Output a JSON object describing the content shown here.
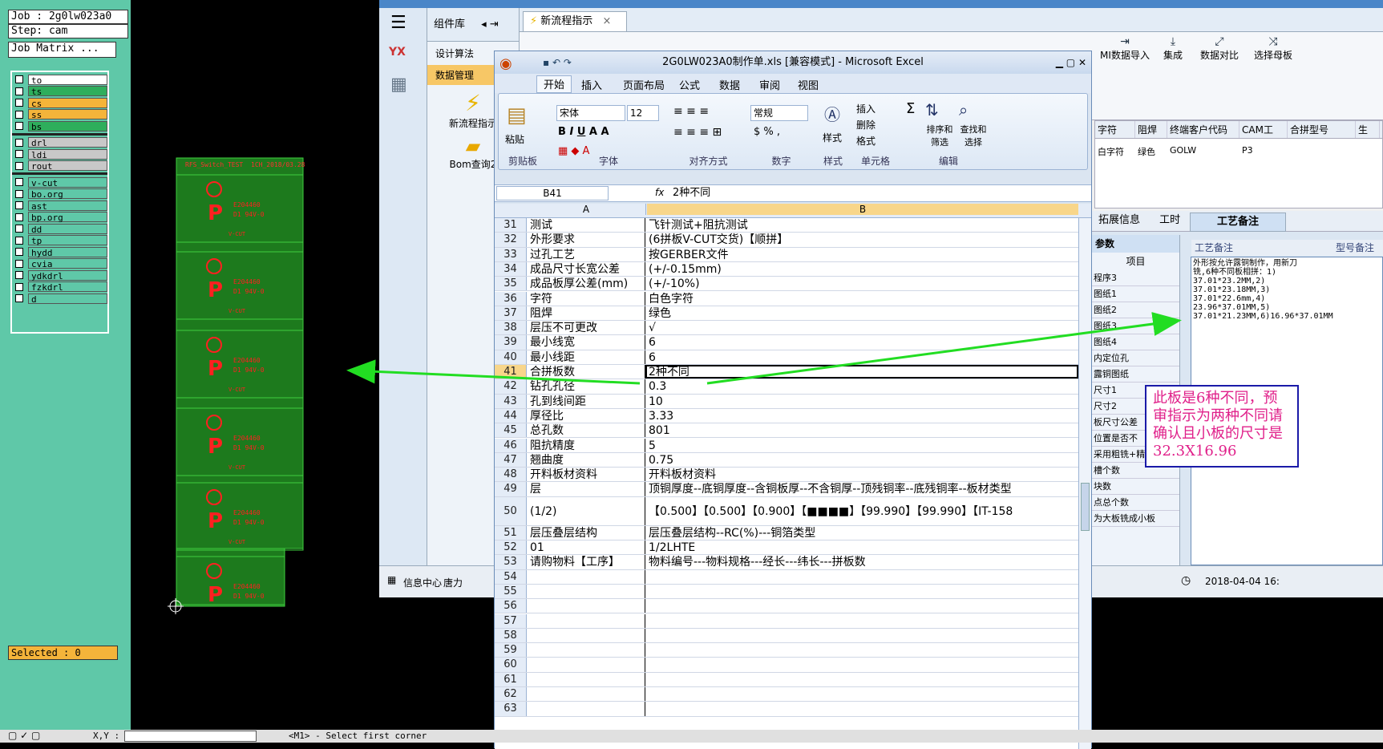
{
  "cam": {
    "job": "Job : 2g0lw023a0",
    "step": "Step: cam",
    "matrix": "Job Matrix ...",
    "layers": [
      {
        "name": "to",
        "color": "#ffffff"
      },
      {
        "name": "ts",
        "color": "#2eae5c"
      },
      {
        "name": "cs",
        "color": "#f4b43a"
      },
      {
        "name": "ss",
        "color": "#f4b43a"
      },
      {
        "name": "bs",
        "color": "#2eae5c"
      },
      {
        "name": "drl",
        "color": "#c8c8c8"
      },
      {
        "name": "ldi",
        "color": "#c8c8c8"
      },
      {
        "name": "rout",
        "color": "#c8c8c8"
      },
      {
        "name": "v-cut",
        "color": "#5fc8a8"
      },
      {
        "name": "bo.org",
        "color": "#5fc8a8"
      },
      {
        "name": "ast",
        "color": "#5fc8a8"
      },
      {
        "name": "bp.org",
        "color": "#5fc8a8"
      },
      {
        "name": "dd",
        "color": "#5fc8a8"
      },
      {
        "name": "tp",
        "color": "#5fc8a8"
      },
      {
        "name": "hydd",
        "color": "#5fc8a8"
      },
      {
        "name": "cvia",
        "color": "#5fc8a8"
      },
      {
        "name": "ydkdrl",
        "color": "#5fc8a8"
      },
      {
        "name": "fzkdrl",
        "color": "#5fc8a8"
      },
      {
        "name": "d",
        "color": "#5fc8a8"
      }
    ],
    "selected": "Selected : 0",
    "pcb_header_left": "RFS_Switch_TEST",
    "pcb_header_right": "1CH_2018/03.28",
    "pcb_code": "E204460",
    "pcb_rating": "D1 94V-0",
    "vcut": "V-CUT",
    "xy": "X,Y :",
    "prompt": "<M1> - Select first corner"
  },
  "bgapp": {
    "complib": "组件库",
    "tab": "新流程指示",
    "nav_items": [
      "设计算法",
      "数据管理"
    ],
    "tool_items": [
      "新流程指示",
      "Bom查询2"
    ],
    "ribbon_buttons": [
      "MI数据导入",
      "集成",
      "数据对比",
      "选择母板"
    ],
    "table_headers": [
      "字符",
      "阻焊",
      "终端客户代码",
      "CAM工",
      "合拼型号",
      "生"
    ],
    "table_row": [
      "白字符",
      "绿色",
      "GOLW",
      "P3"
    ],
    "subtabs": [
      "拓展信息",
      "工时"
    ],
    "left_list_header": "参数",
    "left_list_col": "项目",
    "left_list": [
      "程序3",
      "图纸1",
      "图纸2",
      "图纸3",
      "图纸4",
      "内定位孔",
      "露铜图纸",
      "尺寸1",
      "尺寸2",
      "板尺寸公差",
      "位置是否不",
      "采用粗铣+精铣",
      "槽个数",
      "块数",
      "点总个数",
      "为大板铣成小板"
    ],
    "note_tab": "工艺备注",
    "note_header": "工艺备注",
    "note_header2": "型号备注",
    "note_lines": [
      "外形按允许露铜制作，用新刀",
      "铣,6种不同板相拼：1)",
      "37.01*23.2MM,2)",
      "37.01*23.18MM,3)",
      "37.01*22.6mm,4)",
      "23.96*37.01MM,5)",
      "37.01*21.23MM,6)16.96*37.01MM"
    ],
    "bottom_left": "信息中心",
    "bottom_left2": "唐力",
    "bottom_right": "2018-04-04 16:"
  },
  "excel": {
    "title": "2G0LW023A0制作单.xls [兼容模式] - Microsoft Excel",
    "tabs": [
      "开始",
      "插入",
      "页面布局",
      "公式",
      "数据",
      "审阅",
      "视图"
    ],
    "groups": [
      "剪贴板",
      "字体",
      "对齐方式",
      "数字",
      "样式",
      "单元格",
      "编辑"
    ],
    "paste": "粘贴",
    "font_name": "宋体",
    "font_size": "12",
    "number_format": "常规",
    "insert": "插入",
    "delete": "删除",
    "format": "格式",
    "style": "样式",
    "sort": "排序和筛选",
    "find": "查找和选择",
    "namebox": "B41",
    "formula": "2种不同",
    "col_a": "A",
    "col_b": "B",
    "rows": [
      [
        "31",
        "测试",
        "飞针测试+阻抗测试"
      ],
      [
        "32",
        "外形要求",
        "(6拼板V-CUT交货)【顺拼】"
      ],
      [
        "33",
        "过孔工艺",
        "按GERBER文件"
      ],
      [
        "34",
        "成品尺寸长宽公差",
        "(+/-0.15mm)"
      ],
      [
        "35",
        "成品板厚公差(mm)",
        "(+/-10%)"
      ],
      [
        "36",
        "字符",
        "白色字符"
      ],
      [
        "37",
        "阻焊",
        "绿色"
      ],
      [
        "38",
        "层压不可更改",
        "√"
      ],
      [
        "39",
        "最小线宽",
        "6"
      ],
      [
        "40",
        "最小线距",
        "6"
      ],
      [
        "41",
        "合拼板数",
        "2种不同"
      ],
      [
        "42",
        "钻孔孔径",
        "0.3"
      ],
      [
        "43",
        "孔到线间距",
        "10"
      ],
      [
        "44",
        "厚径比",
        "3.33"
      ],
      [
        "45",
        "总孔数",
        "801"
      ],
      [
        "46",
        "阻抗精度",
        "5"
      ],
      [
        "47",
        "翘曲度",
        "0.75"
      ],
      [
        "48",
        "开料板材资料",
        "开料板材资料"
      ],
      [
        "49",
        "层",
        "顶铜厚度--底铜厚度--含铜板厚--不含铜厚--顶残铜率--底残铜率--板材类型"
      ],
      [
        "50",
        "(1/2)",
        "【0.500】【0.500】【0.900】【■■■■】【99.990】【99.990】【IT-158"
      ],
      [
        "51",
        "层压叠层结构",
        "层压叠层结构--RC(%)---铜箔类型"
      ],
      [
        "52",
        "01",
        "1/2LHTE"
      ],
      [
        "53",
        "请购物料【工序】",
        "物料编号---物料规格---经长---纬长---拼板数"
      ],
      [
        "54",
        "",
        ""
      ],
      [
        "55",
        "",
        ""
      ],
      [
        "56",
        "",
        ""
      ],
      [
        "57",
        "",
        ""
      ],
      [
        "58",
        "",
        ""
      ],
      [
        "59",
        "",
        ""
      ],
      [
        "60",
        "",
        ""
      ],
      [
        "61",
        "",
        ""
      ],
      [
        "62",
        "",
        ""
      ],
      [
        "63",
        "",
        ""
      ]
    ]
  },
  "callout": "此板是6种不同，预审指示为两种不同请确认且小板的尺寸是32.3X16.96",
  "colors": {
    "cam_bg": "#5fc8a8",
    "pcb_green": "#2a9a2a",
    "pcb_red": "#ff2020",
    "arrow": "#22dd22",
    "callout_text": "#e0208a"
  }
}
